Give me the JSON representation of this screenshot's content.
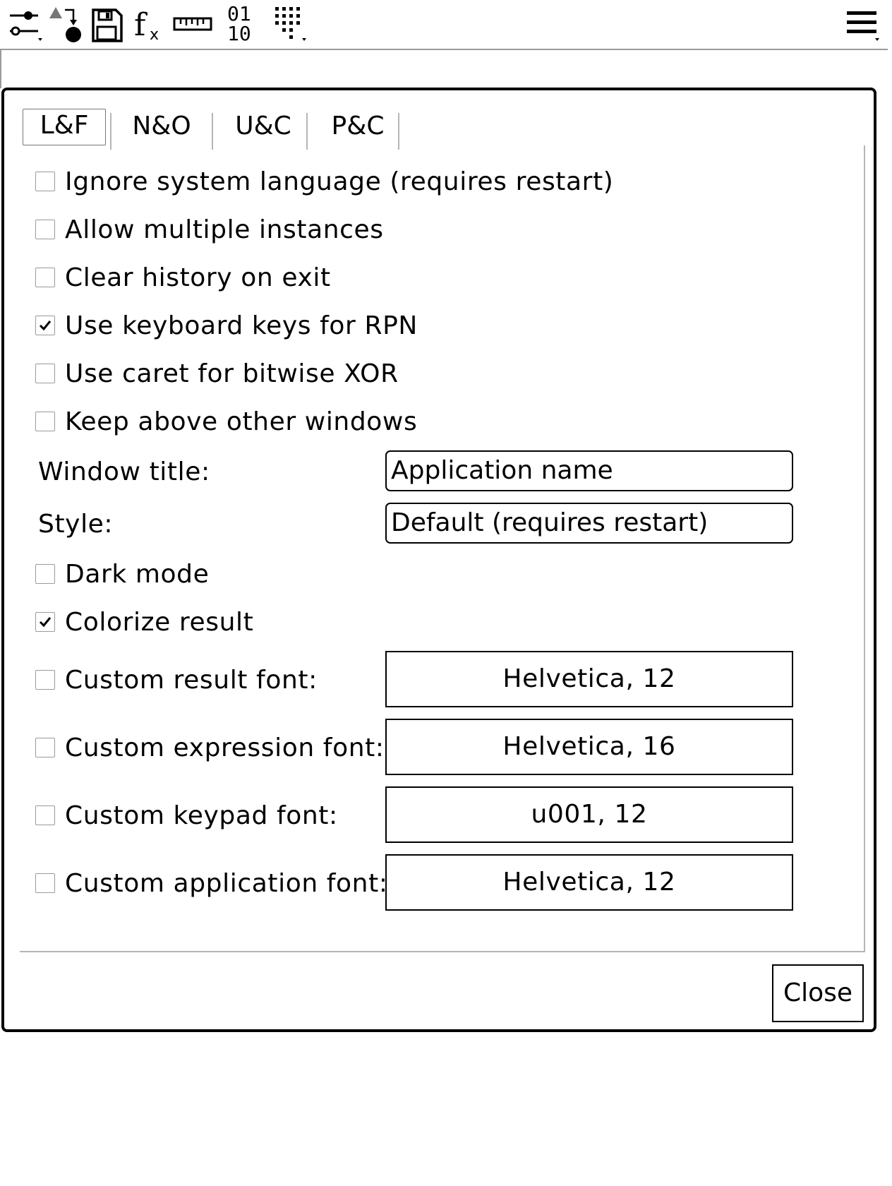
{
  "toolbar": {
    "icons": [
      "settings-sliders-icon",
      "shapes-icon",
      "save-icon",
      "function-icon",
      "ruler-icon",
      "binary-icon",
      "keypad-icon",
      "hamburger-menu-icon"
    ],
    "binary_top": "01",
    "binary_bottom": "10"
  },
  "dialog": {
    "tabs": [
      {
        "label": "L&F",
        "active": true
      },
      {
        "label": "N&O",
        "active": false
      },
      {
        "label": "U&C",
        "active": false
      },
      {
        "label": "P&C",
        "active": false
      }
    ],
    "options": [
      {
        "label": "Ignore system language (requires restart)",
        "checked": false
      },
      {
        "label": "Allow multiple instances",
        "checked": false
      },
      {
        "label": "Clear history on exit",
        "checked": false
      },
      {
        "label": "Use keyboard keys for RPN",
        "checked": true
      },
      {
        "label": "Use caret for bitwise XOR",
        "checked": false
      },
      {
        "label": "Keep above other windows",
        "checked": false
      }
    ],
    "window_title": {
      "label": "Window title:",
      "value": "Application name"
    },
    "style": {
      "label": "Style:",
      "value": "Default (requires restart)"
    },
    "dark_mode": {
      "label": "Dark mode",
      "checked": false
    },
    "colorize_result": {
      "label": "Colorize result",
      "checked": true
    },
    "fonts": [
      {
        "label": "Custom result font:",
        "checked": false,
        "value": "Helvetica, 12"
      },
      {
        "label": "Custom expression font:",
        "checked": false,
        "value": "Helvetica, 16"
      },
      {
        "label": "Custom keypad font:",
        "checked": false,
        "value": "u001, 12"
      },
      {
        "label": "Custom application font:",
        "checked": false,
        "value": "Helvetica, 12"
      }
    ],
    "close_label": "Close"
  }
}
